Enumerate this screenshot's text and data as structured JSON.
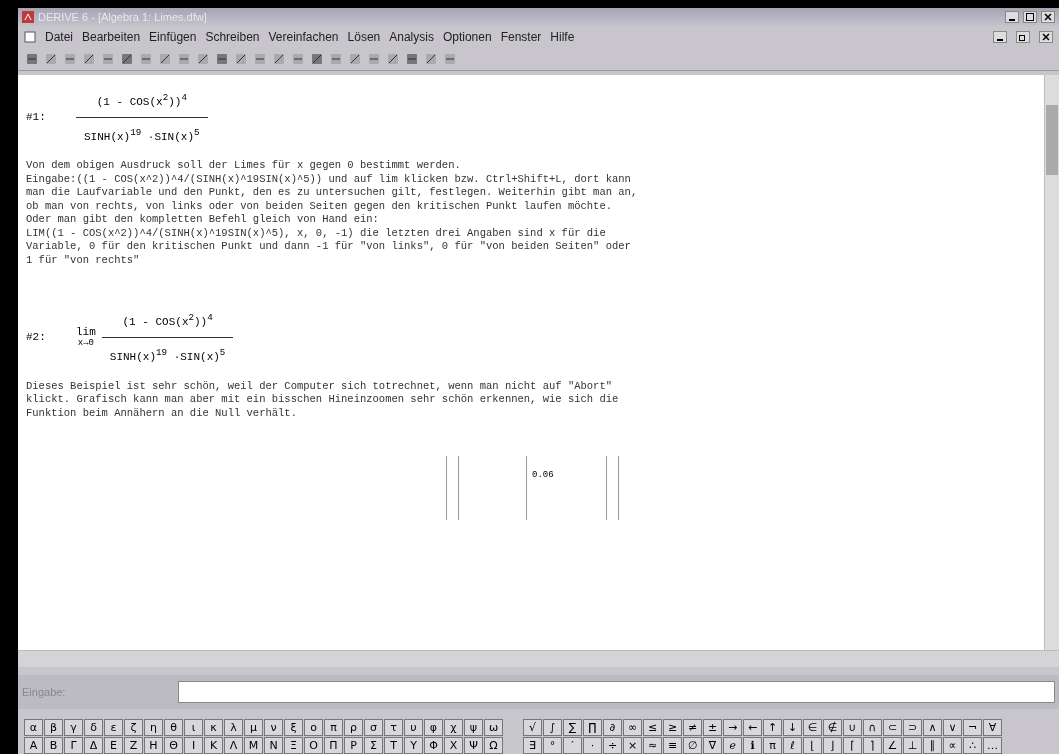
{
  "window": {
    "title": "DERIVE 6 - [Algebra 1: Limes.dfw]"
  },
  "menu": [
    "Datei",
    "Bearbeiten",
    "Einfügen",
    "Schreiben",
    "Vereinfachen",
    "Lösen",
    "Analysis",
    "Optionen",
    "Fenster",
    "Hilfe"
  ],
  "document": [
    {
      "kind": "expr",
      "label": "#1:",
      "limit": false,
      "numerator": "(1 - COS(x$^{2}$))$^{4}$",
      "denominator": "SINH(x)$^{19}$ ·SIN(x)$^{5}$"
    },
    {
      "kind": "text",
      "lines": [
        "Von dem obigen Ausdruck soll der Limes für x gegen 0 bestimmt werden.",
        "Eingabe:((1 - COS(x^2))^4/(SINH(x)^19SIN(x)^5)) und auf lim klicken bzw. Ctrl+Shift+L, dort kann",
        "man die Laufvariable und den Punkt, den es zu untersuchen gilt, festlegen. Weiterhin gibt man an,",
        "ob man von rechts, von links oder von beiden Seiten gegen den kritischen Punkt laufen möchte.",
        "Oder man gibt den kompletten Befehl gleich von Hand ein:",
        "LIM((1 - COS(x^2))^4/(SINH(x)^19SIN(x)^5), x, 0, -1) die letzten drei Angaben sind x für die",
        "Variable, 0 für den kritischen Punkt und dann -1 für \"von links\", 0 für \"von beiden Seiten\" oder",
        "1 für \"von rechts\""
      ]
    },
    {
      "kind": "expr",
      "label": "#2:",
      "limit": true,
      "limit_word": "lim",
      "limit_sub": "x→0",
      "numerator": "(1 - COS(x$^{2}$))$^{4}$",
      "denominator": "SINH(x)$^{19}$ ·SIN(x)$^{5}$"
    },
    {
      "kind": "text",
      "lines": [
        "Dieses Beispiel ist sehr schön, weil der Computer sich totrechnet, wenn man nicht auf \"Abort\"",
        "klickt. Grafisch kann man aber mit ein bisschen Hineinzoomen sehr schön erkennen, wie sich die",
        "Funktion beim Annähern an die Null verhält."
      ]
    },
    {
      "kind": "plot",
      "axis_label": "0.06"
    }
  ],
  "entry": {
    "label": "Eingabe:"
  },
  "palette_left": [
    [
      "α",
      "β",
      "γ",
      "δ",
      "ε",
      "ζ",
      "η",
      "θ",
      "ι",
      "κ",
      "λ",
      "μ",
      "ν",
      "ξ",
      "ο",
      "π",
      "ρ",
      "σ",
      "τ",
      "υ",
      "φ",
      "χ",
      "ψ",
      "ω"
    ],
    [
      "Α",
      "Β",
      "Γ",
      "Δ",
      "Ε",
      "Ζ",
      "Η",
      "Θ",
      "Ι",
      "Κ",
      "Λ",
      "Μ",
      "Ν",
      "Ξ",
      "Ο",
      "Π",
      "Ρ",
      "Σ",
      "Τ",
      "Υ",
      "Φ",
      "Χ",
      "Ψ",
      "Ω"
    ]
  ],
  "palette_right": [
    [
      "√",
      "∫",
      "∑",
      "∏",
      "∂",
      "∞",
      "≤",
      "≥",
      "≠",
      "±",
      "→",
      "←",
      "↑",
      "↓",
      "∈",
      "∉",
      "∪",
      "∩",
      "⊂",
      "⊃",
      "∧",
      "∨",
      "¬",
      "∀"
    ],
    [
      "∃",
      "°",
      "′",
      "·",
      "÷",
      "×",
      "≈",
      "≡",
      "∅",
      "∇",
      "ℯ",
      "ℹ",
      "π",
      "ℓ",
      "⌊",
      "⌋",
      "⌈",
      "⌉",
      "∠",
      "⊥",
      "∥",
      "∝",
      "∴",
      "…"
    ]
  ]
}
